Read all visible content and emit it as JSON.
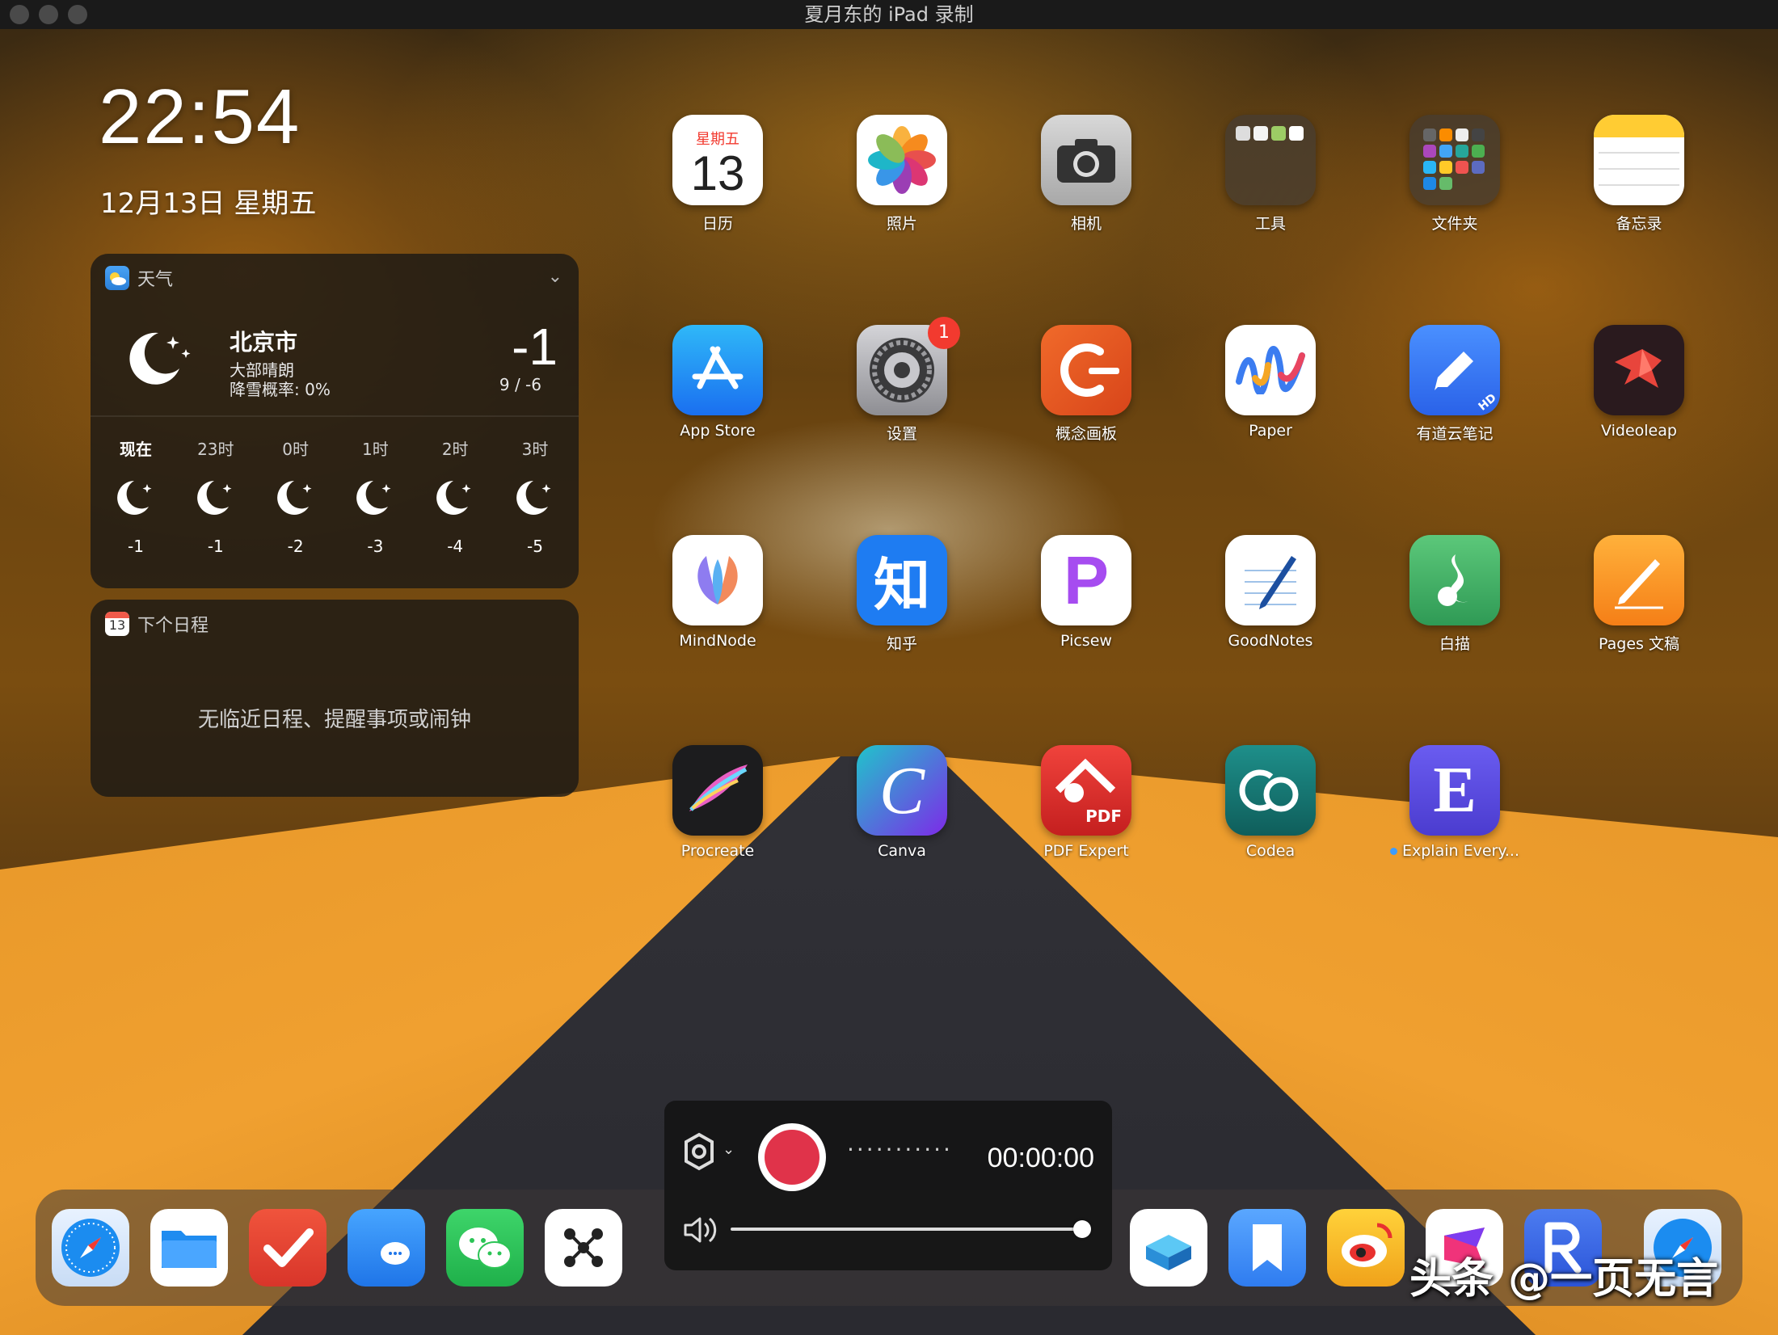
{
  "window": {
    "title": "夏月东的 iPad 录制"
  },
  "lockscreen": {
    "time": "22:54",
    "date": "12月13日 星期五"
  },
  "weather_widget": {
    "app_name": "天气",
    "city": "北京市",
    "condition": "大部晴朗",
    "precip": "降雪概率: 0%",
    "temp_now": "-1",
    "temp_range": "9 / -6",
    "hours": [
      {
        "label": "现在",
        "temp": "-1"
      },
      {
        "label": "23时",
        "temp": "-1"
      },
      {
        "label": "0时",
        "temp": "-2"
      },
      {
        "label": "1时",
        "temp": "-3"
      },
      {
        "label": "2时",
        "temp": "-4"
      },
      {
        "label": "3时",
        "temp": "-5"
      }
    ]
  },
  "calendar_widget": {
    "app_name": "下个日程",
    "icon_day": "13",
    "empty_text": "无临近日程、提醒事项或闹钟"
  },
  "apps": [
    {
      "name": "calendar",
      "label": "日历",
      "icon_weekday": "星期五",
      "icon_day": "13"
    },
    {
      "name": "photos",
      "label": "照片"
    },
    {
      "name": "camera",
      "label": "相机"
    },
    {
      "name": "tools-folder",
      "label": "工具"
    },
    {
      "name": "files-folder",
      "label": "文件夹"
    },
    {
      "name": "notes",
      "label": "备忘录"
    },
    {
      "name": "app-store",
      "label": "App Store"
    },
    {
      "name": "settings",
      "label": "设置",
      "badge": "1"
    },
    {
      "name": "concepts",
      "label": "概念画板"
    },
    {
      "name": "paper",
      "label": "Paper"
    },
    {
      "name": "youdao-note",
      "label": "有道云笔记",
      "icon_text": "HD"
    },
    {
      "name": "videoleap",
      "label": "Videoleap"
    },
    {
      "name": "mindnode",
      "label": "MindNode"
    },
    {
      "name": "zhihu",
      "label": "知乎",
      "icon_text": "知"
    },
    {
      "name": "picsew",
      "label": "Picsew",
      "icon_text": "P"
    },
    {
      "name": "goodnotes",
      "label": "GoodNotes"
    },
    {
      "name": "baimiao",
      "label": "白描"
    },
    {
      "name": "pages",
      "label": "Pages 文稿"
    },
    {
      "name": "procreate",
      "label": "Procreate"
    },
    {
      "name": "canva",
      "label": "Canva",
      "icon_text": "C"
    },
    {
      "name": "pdf-expert",
      "label": "PDF Expert",
      "icon_text": "PDF"
    },
    {
      "name": "codea",
      "label": "Codea"
    },
    {
      "name": "explain-everything",
      "label": "Explain Every...",
      "icon_text": "E"
    }
  ],
  "recorder": {
    "timer": "00:00:00",
    "dots": "···········",
    "volume": 1.0
  },
  "watermark": "头条 @一页无言",
  "colors": {
    "record_red": "#e0334a",
    "badge_red": "#f23a2f"
  }
}
